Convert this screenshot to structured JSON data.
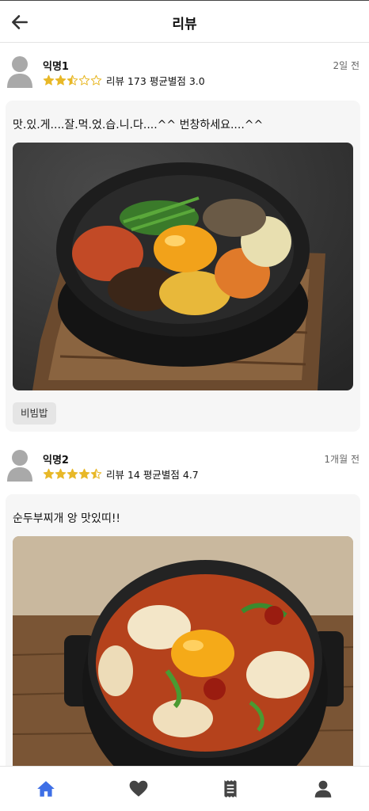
{
  "header": {
    "title": "리뷰",
    "back_icon": "arrow-left-icon"
  },
  "reviews": [
    {
      "author": "익명1",
      "date": "2일 전",
      "rating": 2.5,
      "review_count": "리뷰 173",
      "avg_rating": "평균별점 3.0",
      "text": "맛.있.게....잘.먹.었.습.니.다....^^ 번창하세요....^^",
      "photo": "bibimbap-photo",
      "tag": "비빔밥"
    },
    {
      "author": "익명2",
      "date": "1개월 전",
      "rating": 4.5,
      "review_count": "리뷰 14",
      "avg_rating": "평균별점 4.7",
      "text": "순두부찌개 앙 맛있띠!!",
      "photo": "sundubu-jjigae-photo",
      "tag": ""
    }
  ],
  "colors": {
    "star": "#e8b828",
    "active_nav": "#3e6fe6",
    "inactive_nav": "#444444"
  },
  "nav": [
    {
      "icon": "home-icon",
      "active": true
    },
    {
      "icon": "heart-icon",
      "active": false
    },
    {
      "icon": "receipt-icon",
      "active": false
    },
    {
      "icon": "person-icon",
      "active": false
    }
  ]
}
